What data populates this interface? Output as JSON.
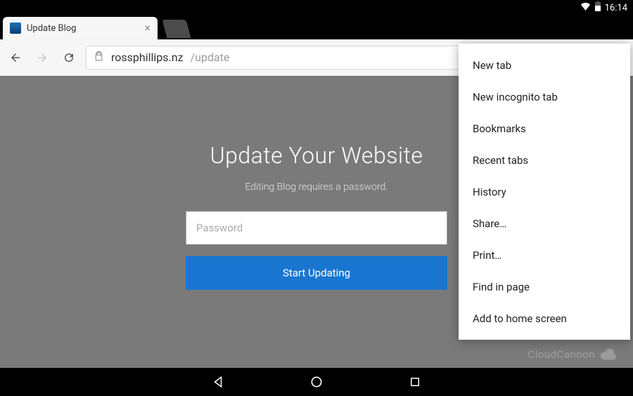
{
  "status_bar": {
    "time": "16:14"
  },
  "tab": {
    "title": "Update Blog"
  },
  "address": {
    "domain": "rossphillips.nz",
    "path": "/update"
  },
  "page": {
    "heading": "Update Your Website",
    "subheading": "Editing Blog requires a password.",
    "password_placeholder": "Password",
    "submit_label": "Start Updating",
    "brand": "CloudCannon"
  },
  "menu": {
    "items": [
      "New tab",
      "New incognito tab",
      "Bookmarks",
      "Recent tabs",
      "History",
      "Share…",
      "Print…",
      "Find in page",
      "Add to home screen"
    ]
  },
  "colors": {
    "accent": "#1876d0",
    "page_bg": "#7a7a7a"
  }
}
